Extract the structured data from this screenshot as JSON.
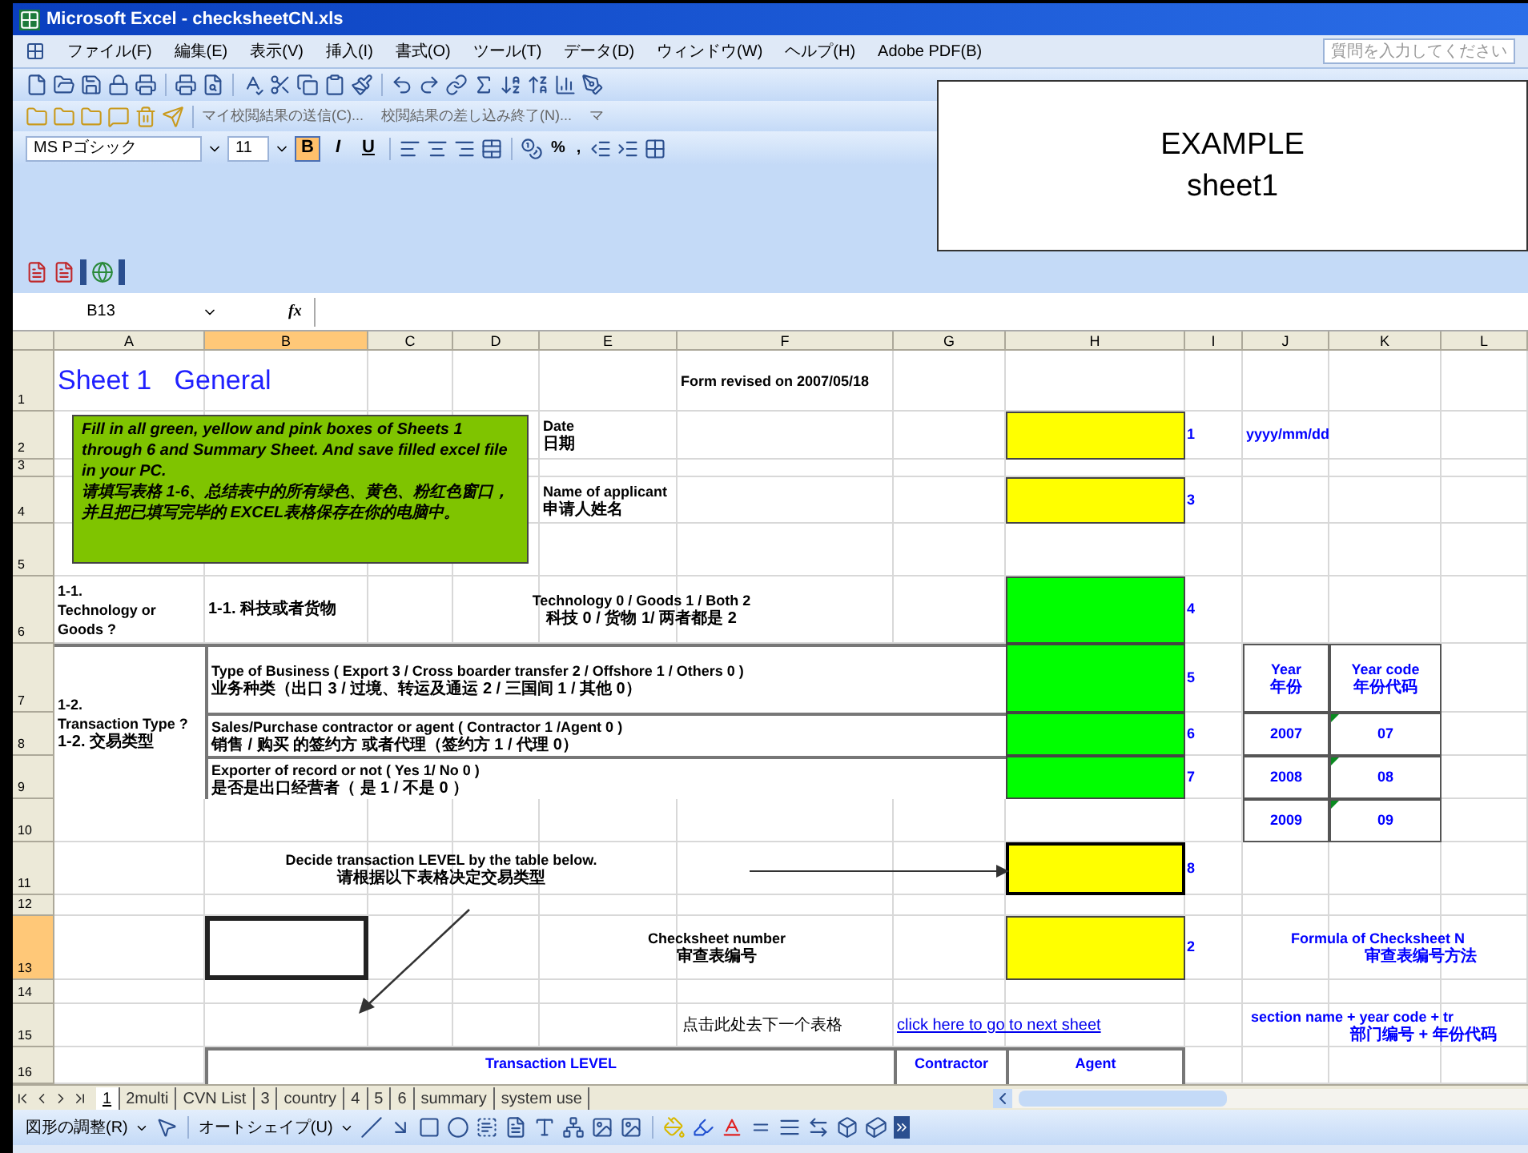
{
  "window": {
    "title": "Microsoft Excel - checksheetCN.xls"
  },
  "menu": [
    "ファイル(F)",
    "編集(E)",
    "表示(V)",
    "挿入(I)",
    "書式(O)",
    "ツール(T)",
    "データ(D)",
    "ウィンドウ(W)",
    "ヘルプ(H)",
    "Adobe PDF(B)"
  ],
  "help_box": {
    "placeholder": "質問を入力してください"
  },
  "review_toolbar": [
    "マイ校閲結果の送信(C)...",
    "校閲結果の差し込み終了(N)...",
    "マ"
  ],
  "format_toolbar": {
    "font": "MS Pゴシック",
    "size": "11",
    "styles": [
      {
        "label": "B",
        "pressed": true
      },
      {
        "label": "I",
        "pressed": false
      },
      {
        "label": "U",
        "pressed": false
      }
    ],
    "percent": "%",
    "comma": ","
  },
  "overlay_note": {
    "lines": [
      "EXAMPLE",
      "sheet1"
    ]
  },
  "formula_bar": {
    "name_box": "B13",
    "function_label": "fx"
  },
  "columns": [
    {
      "label": "A",
      "selected": false
    },
    {
      "label": "B",
      "selected": true
    },
    {
      "label": "C",
      "selected": false
    },
    {
      "label": "D",
      "selected": false
    },
    {
      "label": "E",
      "selected": false
    },
    {
      "label": "F",
      "selected": false
    },
    {
      "label": "G",
      "selected": false
    },
    {
      "label": "H",
      "selected": false
    },
    {
      "label": "I",
      "selected": false
    },
    {
      "label": "J",
      "selected": false
    },
    {
      "label": "K",
      "selected": false
    },
    {
      "label": "L",
      "selected": false
    }
  ],
  "rows": [
    {
      "label": "1",
      "selected": false
    },
    {
      "label": "2",
      "selected": false
    },
    {
      "label": "3",
      "selected": false
    },
    {
      "label": "4",
      "selected": false
    },
    {
      "label": "5",
      "selected": false
    },
    {
      "label": "6",
      "selected": false
    },
    {
      "label": "7",
      "selected": false
    },
    {
      "label": "8",
      "selected": false
    },
    {
      "label": "9",
      "selected": false
    },
    {
      "label": "10",
      "selected": false
    },
    {
      "label": "11",
      "selected": false
    },
    {
      "label": "12",
      "selected": false
    },
    {
      "label": "13",
      "selected": true
    },
    {
      "label": "14",
      "selected": false
    },
    {
      "label": "15",
      "selected": false
    },
    {
      "label": "16",
      "selected": false
    }
  ],
  "sheet": {
    "title": "Sheet 1   General",
    "revised": "Form revised on 2007/05/18",
    "instructions": {
      "en": "Fill in all green, yellow and pink boxes of Sheets 1 through 6 and Summary Sheet. And save filled excel file in your PC.",
      "zh": "请填写表格 1-6、总结表中的所有绿色、黄色、粉红色窗口，并且把已填写完毕的 EXCEL表格保存在你的电脑中。",
      "color": "#7fc400"
    },
    "fields": [
      {
        "label": "Date",
        "label_zh": "日期",
        "color": "#ffff00",
        "number": "1",
        "hint": "yyyy/mm/dd"
      },
      {
        "label": "Name of applicant",
        "label_zh": "申请人姓名",
        "color": "#ffff00",
        "number": "3"
      }
    ],
    "questions": [
      {
        "kind": "single",
        "heading": "1-1.",
        "heading_en": "Technology or Goods ?",
        "heading_zh": "1-1. 科技或者货物",
        "items": [
          {
            "text": "Technology 0 / Goods 1 / Both 2",
            "text_zh": "科技 0 / 货物 1/ 两者都是 2",
            "color": "#00ff00",
            "number": "4"
          }
        ]
      },
      {
        "kind": "multi",
        "heading": "1-2.",
        "heading_en": "Transaction Type ?",
        "heading_zh": "1-2. 交易类型",
        "items": [
          {
            "text": "Type of Business ( Export 3 / Cross boarder transfer 2 / Offshore 1 / Others 0 )",
            "text_zh": "业务种类（出口 3 / 过境、转运及通运 2 / 三国间 1 / 其他 0）",
            "color": "#00ff00",
            "number": "5"
          },
          {
            "text": "Sales/Purchase contractor or agent ( Contractor 1 /Agent 0 )",
            "text_zh": "销售 / 购买 的签约方 或者代理（签约方 1 / 代理 0）",
            "color": "#00ff00",
            "number": "6"
          },
          {
            "text": "Exporter of record or not ( Yes 1/ No 0 )",
            "text_zh": "是否是出口经营者（ 是 1 / 不是 0 ）",
            "color": "#00ff00",
            "number": "7"
          }
        ]
      }
    ],
    "year_table": {
      "headers": [
        {
          "en": "Year",
          "zh": "年份"
        },
        {
          "en": "Year code",
          "zh": "年份代码"
        }
      ],
      "rows": [
        [
          "2007",
          "07"
        ],
        [
          "2008",
          "08"
        ],
        [
          "2009",
          "09"
        ]
      ]
    },
    "level_note": {
      "en": "Decide transaction LEVEL by the table below.",
      "zh": "请根据以下表格决定交易类型",
      "color": "#ffff00",
      "number": "8"
    },
    "checksheet": {
      "label": "Checksheet number",
      "label_zh": "审查表编号",
      "color": "#ffff00",
      "number": "2"
    },
    "formula": {
      "en": "Formula of Checksheet N",
      "zh": "审查表编号方法",
      "example_en": "section name + year code + tr",
      "example_zh": "部门编号 + 年份代码"
    },
    "next_sheet": {
      "label_zh": "点击此处去下一个表格",
      "link": "click here to go to next sheet"
    },
    "level_table": {
      "headers": [
        "Transaction LEVEL",
        "Contractor",
        "Agent"
      ]
    }
  },
  "sheet_tabs": [
    {
      "label": "1",
      "selected": true
    },
    {
      "label": "2multi",
      "selected": false
    },
    {
      "label": "CVN List",
      "selected": false
    },
    {
      "label": "3",
      "selected": false
    },
    {
      "label": "country",
      "selected": false
    },
    {
      "label": "4",
      "selected": false
    },
    {
      "label": "5",
      "selected": false
    },
    {
      "label": "6",
      "selected": false
    },
    {
      "label": "summary",
      "selected": false
    },
    {
      "label": "system use",
      "selected": false
    }
  ],
  "drawing_toolbar": {
    "arrange": "図形の調整(R)",
    "autoshapes": "オートシェイプ(U)"
  }
}
